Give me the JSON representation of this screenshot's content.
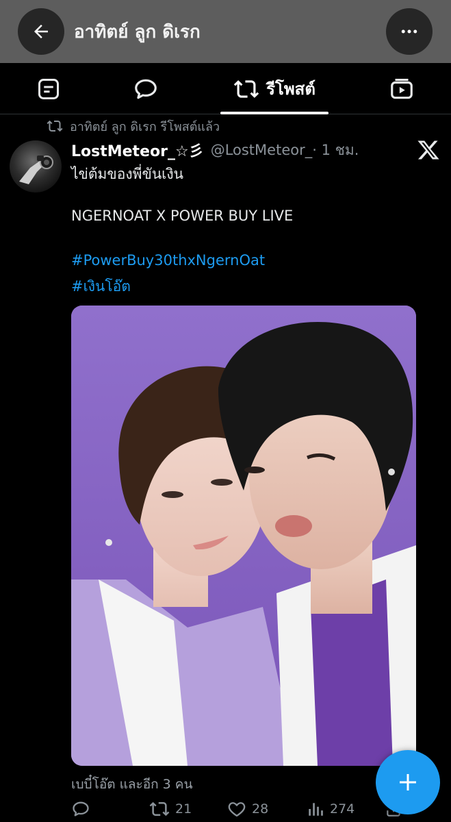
{
  "header": {
    "title": "อาทิตย์ ลูก ดิเรก",
    "back_icon": "arrow-left-icon",
    "more_icon": "more-horizontal-icon",
    "background": "#5d5d5d"
  },
  "tabs": [
    {
      "icon": "article-icon",
      "label": ""
    },
    {
      "icon": "reply-icon",
      "label": ""
    },
    {
      "icon": "repost-icon",
      "label": "รีโพสต์",
      "active": true
    },
    {
      "icon": "video-icon",
      "label": ""
    }
  ],
  "repost_context": {
    "icon": "repost-icon",
    "text": "อาทิตย์ ลูก ดิเรก รีโพสต์แล้ว"
  },
  "post": {
    "display_name": "LostMeteor_☆彡",
    "handle": "@LostMeteor_",
    "time": " · 1 ชม.",
    "source_icon": "x-logo-icon",
    "lines": [
      "ไข่ต้มของพี่ขันเงิน",
      "NGERNOAT X POWER BUY LIVE",
      "#PowerBuy30thxNgernOat",
      "#เงินโอ๊ต"
    ],
    "media_alt": "photo",
    "liked_by": "เบบี๋โอ๊ต และอีก 3 คน",
    "actions": {
      "reply_count": "",
      "repost_count": "21",
      "like_count": "28",
      "view_count": "274"
    }
  },
  "fab": {
    "icon": "plus-icon",
    "color": "#1d9bf0"
  }
}
